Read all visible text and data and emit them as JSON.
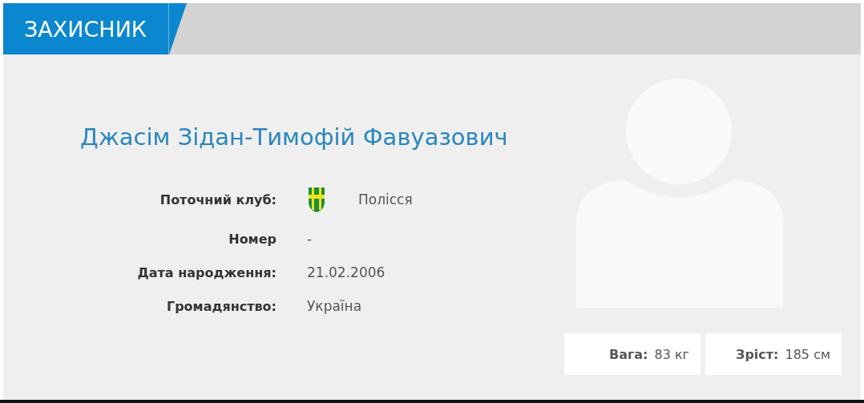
{
  "position": "ЗАХИСНИК",
  "name": "Джасім Зідан-Тимофій Фавуазович",
  "details": [
    {
      "label": "Поточний клуб:",
      "value": "Полісся",
      "kind": "club"
    },
    {
      "label": "Номер",
      "value": "-",
      "kind": "text"
    },
    {
      "label": "Дата народження:",
      "value": "21.02.2006",
      "kind": "text"
    },
    {
      "label": "Громадянство:",
      "value": "Україна",
      "kind": "text"
    }
  ],
  "stats": [
    {
      "label": "Вага:",
      "value": "83 кг"
    },
    {
      "label": "Зріст:",
      "value": "185 см"
    }
  ]
}
